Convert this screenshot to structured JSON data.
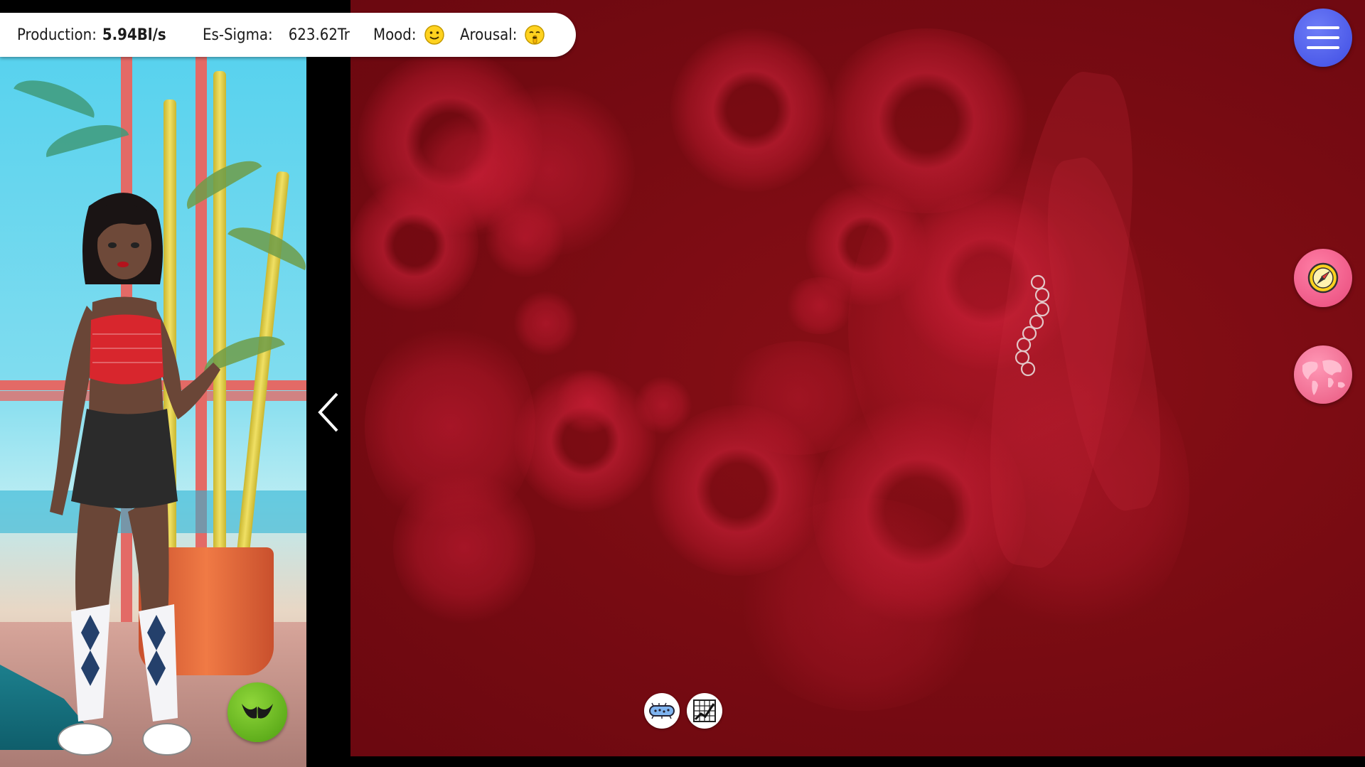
{
  "status_bar": {
    "production_label": "Production:",
    "production_value": "5.94Bl/s",
    "es_sigma_label": "Es-Sigma:",
    "es_sigma_value": "623.62Tr",
    "mood_label": "Mood:",
    "mood_icon": "smiling-face-icon",
    "arousal_label": "Arousal:",
    "arousal_icon": "shushing-face-icon"
  },
  "left_panel": {
    "outfit_icon": "bra-icon",
    "collapse_icon": "chevron-left-icon"
  },
  "right_controls": {
    "menu_icon": "hamburger-menu-icon",
    "compass_icon": "compass-icon",
    "map_icon": "world-map-icon"
  },
  "bottom_controls": {
    "bacteria_icon": "bacteria-icon",
    "chart_icon": "line-chart-icon"
  },
  "colors": {
    "field": "#780b12",
    "cell": "#c81c3a",
    "menu": "#4f5cf0",
    "compass": "#f05c8a",
    "outfit": "#6fbd23",
    "panel_bar": "#ffffff"
  }
}
